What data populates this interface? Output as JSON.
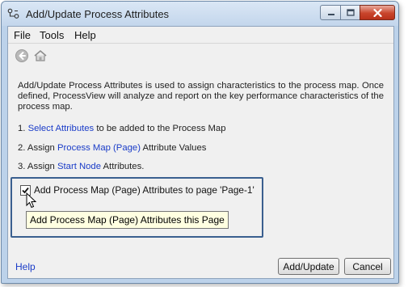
{
  "window": {
    "title": "Add/Update Process Attributes"
  },
  "menu": [
    "File",
    "Tools",
    "Help"
  ],
  "toolbar": {
    "back_icon": "back-arrow-icon",
    "home_icon": "home-icon"
  },
  "description": "Add/Update Process Attributes is used to assign characteristics to the process map.  Once defined, ProcessView will analyze and report on the key performance characteristics of the process map.",
  "steps": [
    {
      "prefix": "1. ",
      "link": "Select Attributes",
      "suffix": " to be added to the Process Map"
    },
    {
      "prefix": "2. Assign ",
      "link": "Process Map (Page)",
      "suffix": " Attribute Values"
    },
    {
      "prefix": "3. Assign ",
      "link": "Start Node",
      "suffix": " Attributes."
    }
  ],
  "checkbox": {
    "label": "Add Process Map (Page) Attributes to page 'Page-1'",
    "checked": true
  },
  "tooltip": "Add Process Map (Page) Attributes this Page",
  "footer": {
    "help_label": "Help",
    "add_update_label": "Add/Update",
    "cancel_label": "Cancel"
  },
  "colors": {
    "link": "#1a3cc8",
    "highlight_border": "#3a5f8f",
    "tooltip_bg": "#ffffe1"
  }
}
